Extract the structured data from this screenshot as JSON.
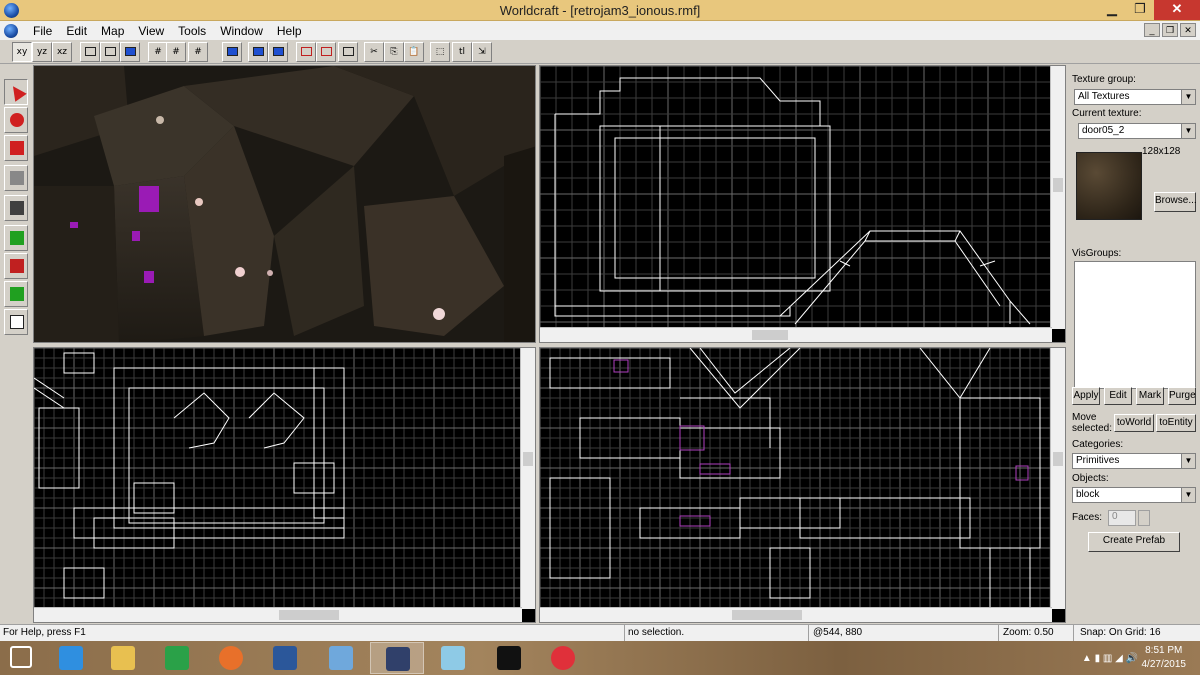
{
  "window": {
    "title": "Worldcraft - [retrojam3_ionous.rmf]",
    "minimize": "▁",
    "maximize": "❐",
    "close": "✕"
  },
  "menu": [
    "File",
    "Edit",
    "Map",
    "View",
    "Tools",
    "Window",
    "Help"
  ],
  "toolbar": [
    {
      "name": "view-xy-button",
      "label": "xy",
      "pressed": true
    },
    {
      "name": "view-yz-button",
      "label": "yz"
    },
    {
      "name": "view-xz-button",
      "label": "xz"
    },
    {
      "name": "wireframe-button",
      "icon": "cube-wire-icon"
    },
    {
      "name": "flat-shaded-button",
      "icon": "cube-flat-icon"
    },
    {
      "name": "textured-button",
      "icon": "cube-textured-icon"
    },
    {
      "name": "grid-button",
      "label": "#"
    },
    {
      "name": "smaller-grid-button",
      "label": "#"
    },
    {
      "name": "larger-grid-button",
      "label": "#"
    },
    {
      "name": "run-map-button",
      "icon": "run-map-icon"
    },
    {
      "name": "group-button",
      "icon": "group-icon"
    },
    {
      "name": "ungroup-button",
      "icon": "ungroup-icon"
    },
    {
      "name": "hide-button",
      "icon": "hide-objects-icon"
    },
    {
      "name": "show-button",
      "icon": "show-objects-icon"
    },
    {
      "name": "carve-button",
      "icon": "carve-icon"
    },
    {
      "name": "cut-button",
      "label": "✂"
    },
    {
      "name": "copy-button",
      "label": "⎘"
    },
    {
      "name": "paste-button",
      "label": "📋"
    },
    {
      "name": "select-button",
      "label": "⬚"
    },
    {
      "name": "texture-lock-button",
      "label": "tl"
    },
    {
      "name": "texture-app-button",
      "label": "⇲"
    }
  ],
  "left_tools": [
    {
      "name": "selection-tool",
      "icon": "arrow-pointer-icon",
      "color": "#d02020",
      "pressed": true
    },
    {
      "name": "magnify-tool",
      "icon": "magnify-icon",
      "color": "#d02020"
    },
    {
      "name": "camera-tool",
      "icon": "camera-icon",
      "color": "#d02020"
    },
    {
      "name": "entity-tool",
      "icon": "entity-icon",
      "color": "#888888"
    },
    {
      "name": "block-tool",
      "icon": "block-icon",
      "color": "#404040"
    },
    {
      "name": "apply-texture-tool",
      "icon": "apply-texture-icon",
      "color": "#20a020"
    },
    {
      "name": "apply-decal-tool",
      "icon": "decal-icon",
      "color": "#c02020"
    },
    {
      "name": "clip-tool",
      "icon": "clip-icon",
      "color": "#20a020"
    },
    {
      "name": "vertex-tool",
      "icon": "vertex-icon",
      "color": "#ffffff"
    }
  ],
  "right_panel": {
    "texture_group_label": "Texture group:",
    "texture_group_value": "All Textures",
    "current_texture_label": "Current texture:",
    "current_texture_value": "door05_2",
    "texture_size": "128x128",
    "browse": "Browse...",
    "visgroups_label": "VisGroups:",
    "apply": "Apply",
    "edit": "Edit",
    "mark": "Mark",
    "purge": "Purge",
    "move_selected": "Move selected:",
    "to_world": "toWorld",
    "to_entity": "toEntity",
    "categories_label": "Categories:",
    "categories_value": "Primitives",
    "objects_label": "Objects:",
    "objects_value": "block",
    "faces_label": "Faces:",
    "faces_value": "0",
    "create_prefab": "Create Prefab"
  },
  "status": {
    "help": "For Help, press F1",
    "selection": "no selection.",
    "coords": "@544, 880",
    "zoom": "Zoom: 0.50",
    "snap": "Snap: On Grid: 16"
  },
  "taskbar": {
    "apps": [
      {
        "name": "start-button",
        "icon": "windows-logo-icon",
        "color": "#ffffff"
      },
      {
        "name": "ie-task",
        "icon": "internet-explorer-icon",
        "color": "#2f8fe0"
      },
      {
        "name": "explorer-task",
        "icon": "folder-icon",
        "color": "#e8c050"
      },
      {
        "name": "store-task",
        "icon": "store-icon",
        "color": "#2aa148"
      },
      {
        "name": "firefox-task",
        "icon": "firefox-icon",
        "color": "#e8702a"
      },
      {
        "name": "word-task",
        "icon": "word-icon",
        "color": "#2b579a"
      },
      {
        "name": "app-task",
        "icon": "blue-window-icon",
        "color": "#6fa8dc"
      },
      {
        "name": "worldcraft-task",
        "icon": "worldcraft-icon",
        "color": "#30406a",
        "active": true
      },
      {
        "name": "glass-task",
        "icon": "glass-icon",
        "color": "#8ecae6"
      },
      {
        "name": "cmd-task",
        "icon": "command-prompt-icon",
        "color": "#111111"
      },
      {
        "name": "itunes-task",
        "icon": "itunes-icon",
        "color": "#e0303a"
      }
    ],
    "time": "8:51 PM",
    "date": "4/27/2015"
  }
}
